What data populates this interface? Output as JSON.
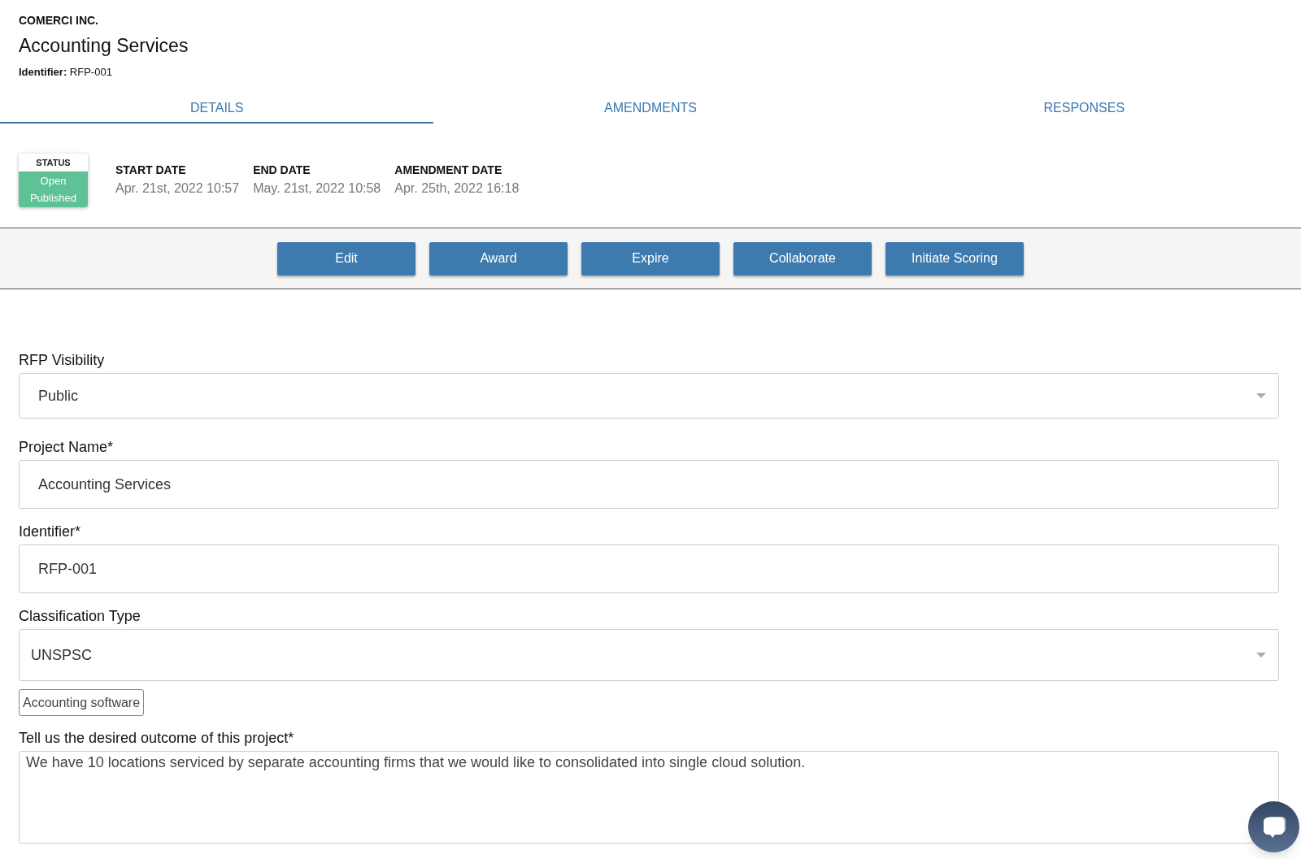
{
  "company": "COMERCI INC.",
  "title": "Accounting Services",
  "identifier": {
    "label": "Identifier:",
    "value": "RFP-001"
  },
  "tabs": [
    {
      "label": "DETAILS",
      "selected": true
    },
    {
      "label": "AMENDMENTS",
      "selected": false
    },
    {
      "label": "RESPONSES",
      "selected": false
    }
  ],
  "status": {
    "label": "STATUS",
    "lines": [
      "Open",
      "Published"
    ]
  },
  "dates": [
    {
      "label": "START DATE",
      "value": "Apr. 21st, 2022 10:57"
    },
    {
      "label": "END DATE",
      "value": "May. 21st, 2022 10:58"
    },
    {
      "label": "AMENDMENT DATE",
      "value": "Apr. 25th, 2022 16:18"
    }
  ],
  "buttons": [
    "Edit",
    "Award",
    "Expire",
    "Collaborate",
    "Initiate Scoring"
  ],
  "fields": [
    {
      "kind": "select",
      "label": "RFP Visibility",
      "value": "Public"
    },
    {
      "kind": "text",
      "label": "Project Name*",
      "value": "Accounting Services"
    },
    {
      "kind": "text",
      "label": "Identifier*",
      "value": "RFP-001"
    },
    {
      "kind": "select",
      "label": "Classification Type",
      "value": "UNSPSC",
      "tags": [
        "Accounting software"
      ]
    },
    {
      "kind": "textarea",
      "label": "Tell us the desired outcome of this project*",
      "value": "We have 10 locations serviced by separate accounting firms that we would like to consolidated into single cloud solution."
    }
  ]
}
